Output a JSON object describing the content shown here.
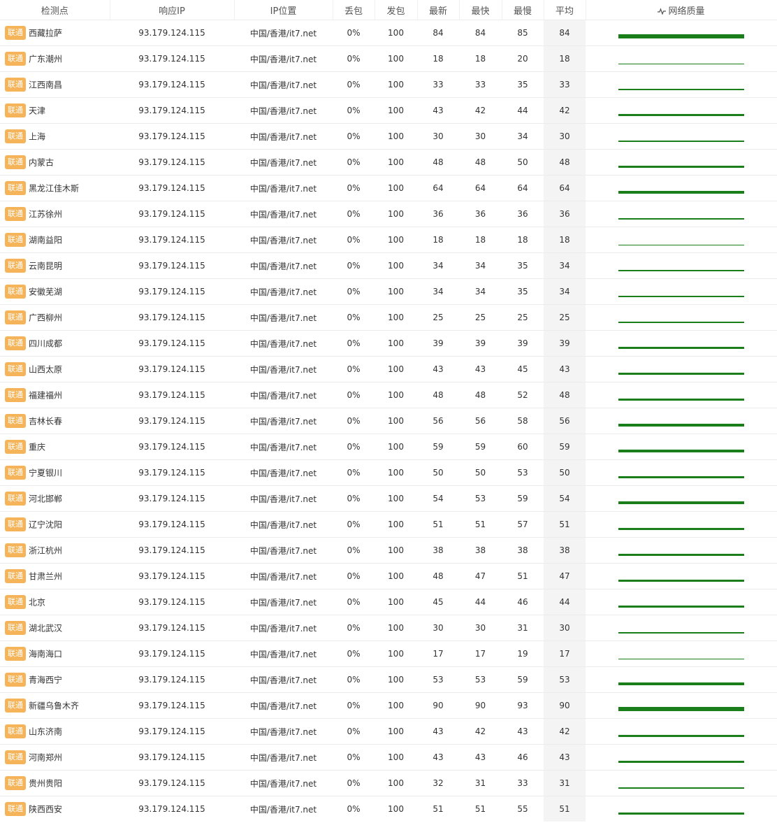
{
  "headers": {
    "node": "检测点",
    "ip": "响应IP",
    "loc": "IP位置",
    "loss": "丢包",
    "sent": "发包",
    "latest": "最新",
    "fastest": "最快",
    "slowest": "最慢",
    "avg": "平均",
    "quality": "网络质量"
  },
  "colors": {
    "isp_badge": "#f5b45a",
    "quality_line": "#1a7f1a",
    "avg_column": "#f4f4f4"
  },
  "rows": [
    {
      "isp": "联通",
      "city": "西藏拉萨",
      "ip": "93.179.124.115",
      "loc": "中国/香港/it7.net",
      "loss": "0%",
      "sent": "100",
      "latest": "84",
      "fastest": "84",
      "slowest": "85",
      "avg": "84"
    },
    {
      "isp": "联通",
      "city": "广东潮州",
      "ip": "93.179.124.115",
      "loc": "中国/香港/it7.net",
      "loss": "0%",
      "sent": "100",
      "latest": "18",
      "fastest": "18",
      "slowest": "20",
      "avg": "18"
    },
    {
      "isp": "联通",
      "city": "江西南昌",
      "ip": "93.179.124.115",
      "loc": "中国/香港/it7.net",
      "loss": "0%",
      "sent": "100",
      "latest": "33",
      "fastest": "33",
      "slowest": "35",
      "avg": "33"
    },
    {
      "isp": "联通",
      "city": "天津",
      "ip": "93.179.124.115",
      "loc": "中国/香港/it7.net",
      "loss": "0%",
      "sent": "100",
      "latest": "43",
      "fastest": "42",
      "slowest": "44",
      "avg": "42"
    },
    {
      "isp": "联通",
      "city": "上海",
      "ip": "93.179.124.115",
      "loc": "中国/香港/it7.net",
      "loss": "0%",
      "sent": "100",
      "latest": "30",
      "fastest": "30",
      "slowest": "34",
      "avg": "30"
    },
    {
      "isp": "联通",
      "city": "内蒙古",
      "ip": "93.179.124.115",
      "loc": "中国/香港/it7.net",
      "loss": "0%",
      "sent": "100",
      "latest": "48",
      "fastest": "48",
      "slowest": "50",
      "avg": "48"
    },
    {
      "isp": "联通",
      "city": "黑龙江佳木斯",
      "ip": "93.179.124.115",
      "loc": "中国/香港/it7.net",
      "loss": "0%",
      "sent": "100",
      "latest": "64",
      "fastest": "64",
      "slowest": "64",
      "avg": "64"
    },
    {
      "isp": "联通",
      "city": "江苏徐州",
      "ip": "93.179.124.115",
      "loc": "中国/香港/it7.net",
      "loss": "0%",
      "sent": "100",
      "latest": "36",
      "fastest": "36",
      "slowest": "36",
      "avg": "36"
    },
    {
      "isp": "联通",
      "city": "湖南益阳",
      "ip": "93.179.124.115",
      "loc": "中国/香港/it7.net",
      "loss": "0%",
      "sent": "100",
      "latest": "18",
      "fastest": "18",
      "slowest": "18",
      "avg": "18"
    },
    {
      "isp": "联通",
      "city": "云南昆明",
      "ip": "93.179.124.115",
      "loc": "中国/香港/it7.net",
      "loss": "0%",
      "sent": "100",
      "latest": "34",
      "fastest": "34",
      "slowest": "35",
      "avg": "34"
    },
    {
      "isp": "联通",
      "city": "安徽芜湖",
      "ip": "93.179.124.115",
      "loc": "中国/香港/it7.net",
      "loss": "0%",
      "sent": "100",
      "latest": "34",
      "fastest": "34",
      "slowest": "35",
      "avg": "34"
    },
    {
      "isp": "联通",
      "city": "广西柳州",
      "ip": "93.179.124.115",
      "loc": "中国/香港/it7.net",
      "loss": "0%",
      "sent": "100",
      "latest": "25",
      "fastest": "25",
      "slowest": "25",
      "avg": "25"
    },
    {
      "isp": "联通",
      "city": "四川成都",
      "ip": "93.179.124.115",
      "loc": "中国/香港/it7.net",
      "loss": "0%",
      "sent": "100",
      "latest": "39",
      "fastest": "39",
      "slowest": "39",
      "avg": "39"
    },
    {
      "isp": "联通",
      "city": "山西太原",
      "ip": "93.179.124.115",
      "loc": "中国/香港/it7.net",
      "loss": "0%",
      "sent": "100",
      "latest": "43",
      "fastest": "43",
      "slowest": "45",
      "avg": "43"
    },
    {
      "isp": "联通",
      "city": "福建福州",
      "ip": "93.179.124.115",
      "loc": "中国/香港/it7.net",
      "loss": "0%",
      "sent": "100",
      "latest": "48",
      "fastest": "48",
      "slowest": "52",
      "avg": "48"
    },
    {
      "isp": "联通",
      "city": "吉林长春",
      "ip": "93.179.124.115",
      "loc": "中国/香港/it7.net",
      "loss": "0%",
      "sent": "100",
      "latest": "56",
      "fastest": "56",
      "slowest": "58",
      "avg": "56"
    },
    {
      "isp": "联通",
      "city": "重庆",
      "ip": "93.179.124.115",
      "loc": "中国/香港/it7.net",
      "loss": "0%",
      "sent": "100",
      "latest": "59",
      "fastest": "59",
      "slowest": "60",
      "avg": "59"
    },
    {
      "isp": "联通",
      "city": "宁夏银川",
      "ip": "93.179.124.115",
      "loc": "中国/香港/it7.net",
      "loss": "0%",
      "sent": "100",
      "latest": "50",
      "fastest": "50",
      "slowest": "53",
      "avg": "50"
    },
    {
      "isp": "联通",
      "city": "河北邯郸",
      "ip": "93.179.124.115",
      "loc": "中国/香港/it7.net",
      "loss": "0%",
      "sent": "100",
      "latest": "54",
      "fastest": "53",
      "slowest": "59",
      "avg": "54"
    },
    {
      "isp": "联通",
      "city": "辽宁沈阳",
      "ip": "93.179.124.115",
      "loc": "中国/香港/it7.net",
      "loss": "0%",
      "sent": "100",
      "latest": "51",
      "fastest": "51",
      "slowest": "57",
      "avg": "51"
    },
    {
      "isp": "联通",
      "city": "浙江杭州",
      "ip": "93.179.124.115",
      "loc": "中国/香港/it7.net",
      "loss": "0%",
      "sent": "100",
      "latest": "38",
      "fastest": "38",
      "slowest": "38",
      "avg": "38"
    },
    {
      "isp": "联通",
      "city": "甘肃兰州",
      "ip": "93.179.124.115",
      "loc": "中国/香港/it7.net",
      "loss": "0%",
      "sent": "100",
      "latest": "48",
      "fastest": "47",
      "slowest": "51",
      "avg": "47"
    },
    {
      "isp": "联通",
      "city": "北京",
      "ip": "93.179.124.115",
      "loc": "中国/香港/it7.net",
      "loss": "0%",
      "sent": "100",
      "latest": "45",
      "fastest": "44",
      "slowest": "46",
      "avg": "44"
    },
    {
      "isp": "联通",
      "city": "湖北武汉",
      "ip": "93.179.124.115",
      "loc": "中国/香港/it7.net",
      "loss": "0%",
      "sent": "100",
      "latest": "30",
      "fastest": "30",
      "slowest": "31",
      "avg": "30"
    },
    {
      "isp": "联通",
      "city": "海南海口",
      "ip": "93.179.124.115",
      "loc": "中国/香港/it7.net",
      "loss": "0%",
      "sent": "100",
      "latest": "17",
      "fastest": "17",
      "slowest": "19",
      "avg": "17"
    },
    {
      "isp": "联通",
      "city": "青海西宁",
      "ip": "93.179.124.115",
      "loc": "中国/香港/it7.net",
      "loss": "0%",
      "sent": "100",
      "latest": "53",
      "fastest": "53",
      "slowest": "59",
      "avg": "53"
    },
    {
      "isp": "联通",
      "city": "新疆乌鲁木齐",
      "ip": "93.179.124.115",
      "loc": "中国/香港/it7.net",
      "loss": "0%",
      "sent": "100",
      "latest": "90",
      "fastest": "90",
      "slowest": "93",
      "avg": "90"
    },
    {
      "isp": "联通",
      "city": "山东济南",
      "ip": "93.179.124.115",
      "loc": "中国/香港/it7.net",
      "loss": "0%",
      "sent": "100",
      "latest": "43",
      "fastest": "42",
      "slowest": "43",
      "avg": "42"
    },
    {
      "isp": "联通",
      "city": "河南郑州",
      "ip": "93.179.124.115",
      "loc": "中国/香港/it7.net",
      "loss": "0%",
      "sent": "100",
      "latest": "43",
      "fastest": "43",
      "slowest": "46",
      "avg": "43"
    },
    {
      "isp": "联通",
      "city": "贵州贵阳",
      "ip": "93.179.124.115",
      "loc": "中国/香港/it7.net",
      "loss": "0%",
      "sent": "100",
      "latest": "32",
      "fastest": "31",
      "slowest": "33",
      "avg": "31"
    },
    {
      "isp": "联通",
      "city": "陕西西安",
      "ip": "93.179.124.115",
      "loc": "中国/香港/it7.net",
      "loss": "0%",
      "sent": "100",
      "latest": "51",
      "fastest": "51",
      "slowest": "55",
      "avg": "51"
    }
  ]
}
